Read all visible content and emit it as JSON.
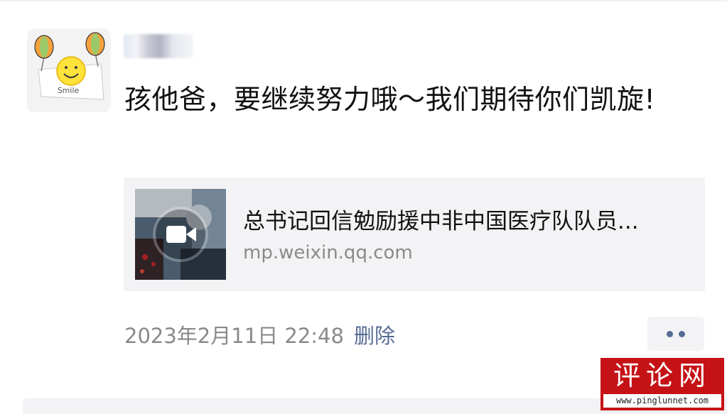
{
  "post": {
    "text": "孩他爸，要继续努力哦～我们期待你们凯旋!",
    "timestamp": "2023年2月11日 22:48",
    "delete_label": "删除"
  },
  "share_card": {
    "title": "总书记回信勉励援中非中国医疗队队员...",
    "domain": "mp.weixin.qq.com",
    "thumb_icon": "video-camera-icon"
  },
  "avatar": {
    "caption": "Smile",
    "icon": "smiley-balloons-icon"
  },
  "more": {
    "icon": "more-dots-icon"
  },
  "watermark": {
    "title": "评论网",
    "url": "www.pinglunnet.com"
  },
  "colors": {
    "link": "#576b95",
    "meta": "#8a8a8a",
    "card_bg": "#f3f3f5",
    "watermark_red": "#c51216"
  }
}
